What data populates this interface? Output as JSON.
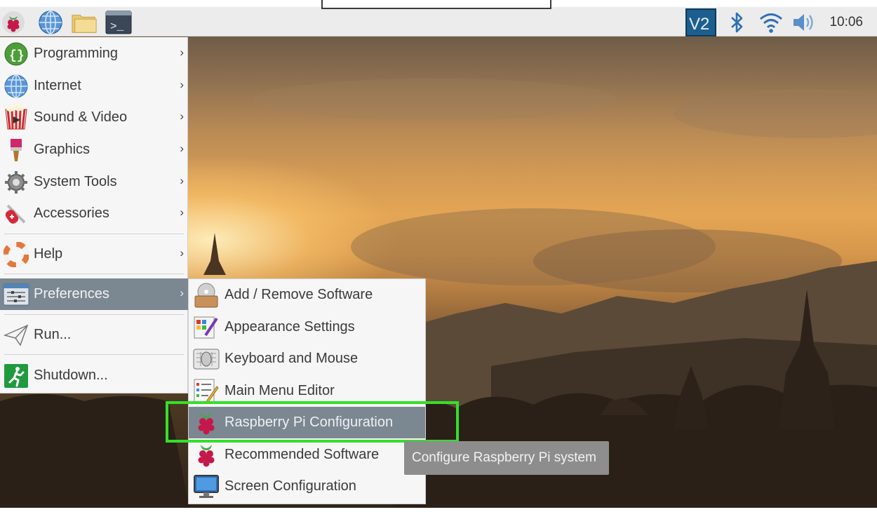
{
  "panel": {
    "clock": "10:06",
    "launchers": [
      "raspberry-menu-icon",
      "web-browser-icon",
      "file-manager-icon",
      "terminal-icon"
    ],
    "tray": [
      "vnc-icon",
      "bluetooth-icon",
      "wifi-icon",
      "volume-icon"
    ]
  },
  "main_menu": {
    "items": [
      {
        "label": "Programming",
        "icon": "programming-icon"
      },
      {
        "label": "Internet",
        "icon": "internet-icon"
      },
      {
        "label": "Sound & Video",
        "icon": "sound-video-icon"
      },
      {
        "label": "Graphics",
        "icon": "graphics-icon"
      },
      {
        "label": "System Tools",
        "icon": "system-tools-icon"
      },
      {
        "label": "Accessories",
        "icon": "accessories-icon"
      },
      {
        "label": "Help",
        "icon": "help-icon"
      },
      {
        "label": "Preferences",
        "icon": "preferences-icon"
      },
      {
        "label": "Run...",
        "icon": "run-icon"
      },
      {
        "label": "Shutdown...",
        "icon": "shutdown-icon"
      }
    ],
    "arrow": "›"
  },
  "preferences_menu": {
    "items": [
      {
        "label": "Add / Remove Software",
        "icon": "add-remove-software-icon"
      },
      {
        "label": "Appearance Settings",
        "icon": "appearance-settings-icon"
      },
      {
        "label": "Keyboard and Mouse",
        "icon": "keyboard-mouse-icon"
      },
      {
        "label": "Main Menu Editor",
        "icon": "menu-editor-icon"
      },
      {
        "label": "Raspberry Pi Configuration",
        "icon": "raspberry-config-icon"
      },
      {
        "label": "Recommended Software",
        "icon": "recommended-software-icon"
      },
      {
        "label": "Screen Configuration",
        "icon": "screen-config-icon"
      }
    ]
  },
  "tooltip": "Configure Raspberry Pi system",
  "colors": {
    "menu_bg": "#f6f6f6",
    "selected_bg": "#7b8791",
    "highlight_box": "#34e02a",
    "panel_bg": "#ececec",
    "tooltip_bg": "#8d8d8d"
  }
}
